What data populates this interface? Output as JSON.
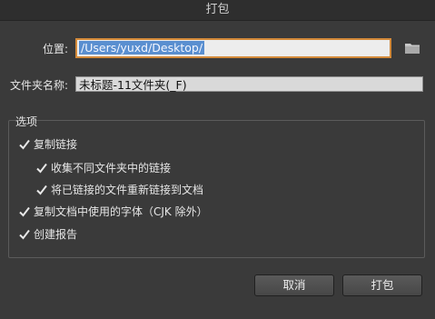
{
  "window": {
    "title": "打包"
  },
  "location": {
    "label": "位置:",
    "value": "/Users/yuxd/Desktop/"
  },
  "folder_name": {
    "label": "文件夹名称:",
    "value": "未标题-11文件夹(_F)"
  },
  "options": {
    "title": "选项",
    "items": [
      {
        "label": "复制链接",
        "checked": true
      },
      {
        "label": "收集不同文件夹中的链接",
        "checked": true
      },
      {
        "label": "将已链接的文件重新链接到文档",
        "checked": true
      },
      {
        "label": "复制文档中使用的字体（CJK 除外）",
        "checked": true
      },
      {
        "label": "创建报告",
        "checked": true
      }
    ]
  },
  "buttons": {
    "cancel": "取消",
    "package": "打包"
  },
  "icons": {
    "browse": "folder-icon",
    "checkbox": "checkmark-icon"
  },
  "colors": {
    "focus_ring": "#d38a3a",
    "selection": "#5a8fd0"
  }
}
